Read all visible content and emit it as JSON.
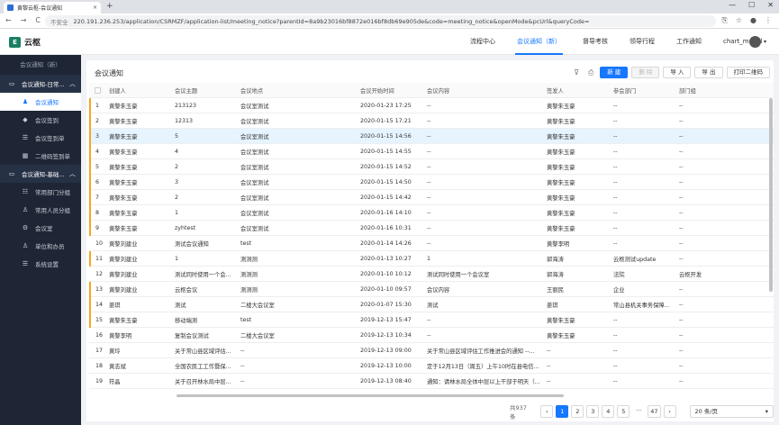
{
  "browser": {
    "tab_title": "黄黎云枢-会议通知",
    "tab_close": "×",
    "new_tab": "+",
    "win": [
      "—",
      "☐",
      "✕"
    ],
    "nav": [
      "←",
      "→",
      "C"
    ],
    "insecure": "不安全",
    "url": "220.191.236.253/application/CSRMZF/application-list/meeting_notice?parentId=8a9b23016bf8872e016bf8db69e905de&code=meeting_notice&openMode&pcUrl&queryCode=",
    "right_icons": [
      "⎘",
      "☆",
      "●",
      "⋮"
    ]
  },
  "app": {
    "logo": "云枢",
    "logo_mark": "E",
    "topnav": [
      {
        "label": "流程中心",
        "active": false
      },
      {
        "label": "会议通知（新）",
        "active": true
      },
      {
        "label": "督导考核",
        "active": false
      },
      {
        "label": "领导行程",
        "active": false
      },
      {
        "label": "工作通知",
        "active": false
      },
      {
        "label": "chart_model",
        "active": false
      }
    ],
    "avatar_caret": "▾"
  },
  "sidebar": {
    "title": "会议通知（新）",
    "groups": [
      {
        "label": "会议通知-日常...",
        "icon": "folder-icon",
        "caret": "︿",
        "items": [
          {
            "label": "会议通知",
            "icon": "people-icon",
            "active": true
          },
          {
            "label": "会议签到",
            "icon": "tag-icon",
            "active": false
          },
          {
            "label": "会议签到单",
            "icon": "list-icon",
            "active": false
          },
          {
            "label": "二维码签到单",
            "icon": "qrcode-icon",
            "active": false
          }
        ]
      },
      {
        "label": "会议通知-基础...",
        "icon": "folder-icon",
        "caret": "︿",
        "items": [
          {
            "label": "常用部门分组",
            "icon": "org-icon",
            "active": false
          },
          {
            "label": "常用人员分组",
            "icon": "user-icon",
            "active": false
          },
          {
            "label": "会议室",
            "icon": "room-icon",
            "active": false
          },
          {
            "label": "单位和办员",
            "icon": "person-icon",
            "active": false
          },
          {
            "label": "系统设置",
            "icon": "settings-icon",
            "active": false
          }
        ]
      }
    ]
  },
  "main": {
    "title": "会议通知",
    "tool_icons": [
      "filter-icon",
      "print-icon"
    ],
    "buttons": {
      "new": "新 建",
      "delete": "删 除",
      "import": "导 入",
      "export": "导 出",
      "qrcode": "打印二维码"
    },
    "columns": [
      "创建人",
      "会议主题",
      "会议地点",
      "会议开始时间",
      "会议内容",
      "签发人",
      "参会部门",
      "部门组"
    ],
    "rows": [
      {
        "n": "1",
        "creator": "黄黎朱玉豪",
        "topic": "213123",
        "place": "会议室测试",
        "time": "2020-01-23 17:25",
        "content": "--",
        "signer": "黄黎朱玉豪",
        "dept": "--",
        "group": "--",
        "mark": true,
        "sel": false
      },
      {
        "n": "2",
        "creator": "黄黎朱玉豪",
        "topic": "12313",
        "place": "会议室测试",
        "time": "2020-01-15 17:21",
        "content": "--",
        "signer": "黄黎朱玉豪",
        "dept": "--",
        "group": "--",
        "mark": true,
        "sel": false
      },
      {
        "n": "3",
        "creator": "黄黎朱玉豪",
        "topic": "5",
        "place": "会议室测试",
        "time": "2020-01-15 14:56",
        "content": "--",
        "signer": "黄黎朱玉豪",
        "dept": "--",
        "group": "--",
        "mark": true,
        "sel": true
      },
      {
        "n": "4",
        "creator": "黄黎朱玉豪",
        "topic": "4",
        "place": "会议室测试",
        "time": "2020-01-15 14:55",
        "content": "--",
        "signer": "黄黎朱玉豪",
        "dept": "--",
        "group": "--",
        "mark": true,
        "sel": false
      },
      {
        "n": "5",
        "creator": "黄黎朱玉豪",
        "topic": "2",
        "place": "会议室测试",
        "time": "2020-01-15 14:52",
        "content": "--",
        "signer": "黄黎朱玉豪",
        "dept": "--",
        "group": "--",
        "mark": true,
        "sel": false
      },
      {
        "n": "6",
        "creator": "黄黎朱玉豪",
        "topic": "3",
        "place": "会议室测试",
        "time": "2020-01-15 14:50",
        "content": "--",
        "signer": "黄黎朱玉豪",
        "dept": "--",
        "group": "--",
        "mark": true,
        "sel": false
      },
      {
        "n": "7",
        "creator": "黄黎朱玉豪",
        "topic": "2",
        "place": "会议室测试",
        "time": "2020-01-15 14:42",
        "content": "--",
        "signer": "黄黎朱玉豪",
        "dept": "--",
        "group": "--",
        "mark": true,
        "sel": false
      },
      {
        "n": "8",
        "creator": "黄黎朱玉豪",
        "topic": "1",
        "place": "会议室测试",
        "time": "2020-01-16 14:10",
        "content": "--",
        "signer": "黄黎朱玉豪",
        "dept": "--",
        "group": "--",
        "mark": true,
        "sel": false
      },
      {
        "n": "9",
        "creator": "黄黎朱玉豪",
        "topic": "zyhtest",
        "place": "会议室测试",
        "time": "2020-01-16 10:31",
        "content": "--",
        "signer": "黄黎朱玉豪",
        "dept": "--",
        "group": "--",
        "mark": true,
        "sel": false
      },
      {
        "n": "10",
        "creator": "黄黎刘建业",
        "topic": "测试会议通知",
        "place": "test",
        "time": "2020-01-14 14:26",
        "content": "--",
        "signer": "黄黎李明",
        "dept": "--",
        "group": "--",
        "mark": false,
        "sel": false
      },
      {
        "n": "11",
        "creator": "黄黎刘建业",
        "topic": "1",
        "place": "测测测",
        "time": "2020-01-13 10:27",
        "content": "1",
        "signer": "郭海涛",
        "dept": "云枢测试update",
        "group": "--",
        "mark": true,
        "sel": false
      },
      {
        "n": "12",
        "creator": "黄黎刘建业",
        "topic": "测试同时使用一个会...",
        "place": "测测测",
        "time": "2020-01-10 10:12",
        "content": "测试同时使用一个会议室",
        "signer": "郭海涛",
        "dept": "法院",
        "group": "云枢开发",
        "mark": false,
        "sel": false
      },
      {
        "n": "13",
        "creator": "黄黎刘建业",
        "topic": "云枢会议",
        "place": "测测测",
        "time": "2020-01-10 09:57",
        "content": "会议内容",
        "signer": "王丽民",
        "dept": "企业",
        "group": "--",
        "mark": true,
        "sel": false
      },
      {
        "n": "14",
        "creator": "姜琪",
        "topic": "测试",
        "place": "二楼大会议室",
        "time": "2020-01-07 15:30",
        "content": "测试",
        "signer": "姜琪",
        "dept": "常山县机关事务保障...",
        "group": "--",
        "mark": true,
        "sel": false
      },
      {
        "n": "15",
        "creator": "黄黎朱玉豪",
        "topic": "移动端测",
        "place": "test",
        "time": "2019-12-13 15:47",
        "content": "--",
        "signer": "黄黎朱玉豪",
        "dept": "--",
        "group": "--",
        "mark": true,
        "sel": false
      },
      {
        "n": "16",
        "creator": "黄黎李明",
        "topic": "复制会议测试",
        "place": "二楼大会议室",
        "time": "2019-12-13 10:34",
        "content": "--",
        "signer": "黄黎朱玉豪",
        "dept": "--",
        "group": "--",
        "mark": false,
        "sel": false
      },
      {
        "n": "17",
        "creator": "黄玲",
        "topic": "关于常山县区域评估...",
        "place": "--",
        "time": "2019-12-13 09:00",
        "content": "关于常山县区域评估工作推进会的通知 --...",
        "signer": "--",
        "dept": "--",
        "group": "--",
        "mark": false,
        "sel": false
      },
      {
        "n": "18",
        "creator": "黄志斌",
        "topic": "全国农民工工作暨保...",
        "place": "--",
        "time": "2019-12-13 10:00",
        "content": "定于12月13日（周五）上午10时在县电信...",
        "signer": "--",
        "dept": "--",
        "group": "--",
        "mark": false,
        "sel": false
      },
      {
        "n": "19",
        "creator": "符晶",
        "topic": "关于召开林水局中层...",
        "place": "--",
        "time": "2019-12-13 08:40",
        "content": "通知：请林水局全体中层以上干部于明天（...",
        "signer": "--",
        "dept": "--",
        "group": "--",
        "mark": false,
        "sel": false
      }
    ],
    "pager": {
      "total": "共937条",
      "prev": "‹",
      "pages": [
        "1",
        "2",
        "3",
        "4",
        "5"
      ],
      "dots": "···",
      "last": "47",
      "next": "›",
      "size": "20 条/页",
      "active": "1"
    }
  }
}
